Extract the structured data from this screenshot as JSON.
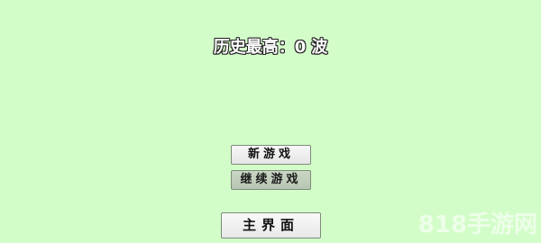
{
  "header": {
    "best_label": "历史最高：",
    "best_value": "0",
    "best_unit": "波"
  },
  "menu": {
    "new_game_label": "新游戏",
    "continue_label": "继续游戏",
    "main_menu_label": "主界面"
  },
  "watermark": {
    "text": "818手游网"
  },
  "colors": {
    "background": "#d3fdc8",
    "button_face": "#f2f2f2",
    "button_disabled_face": "#c1cfbc"
  }
}
